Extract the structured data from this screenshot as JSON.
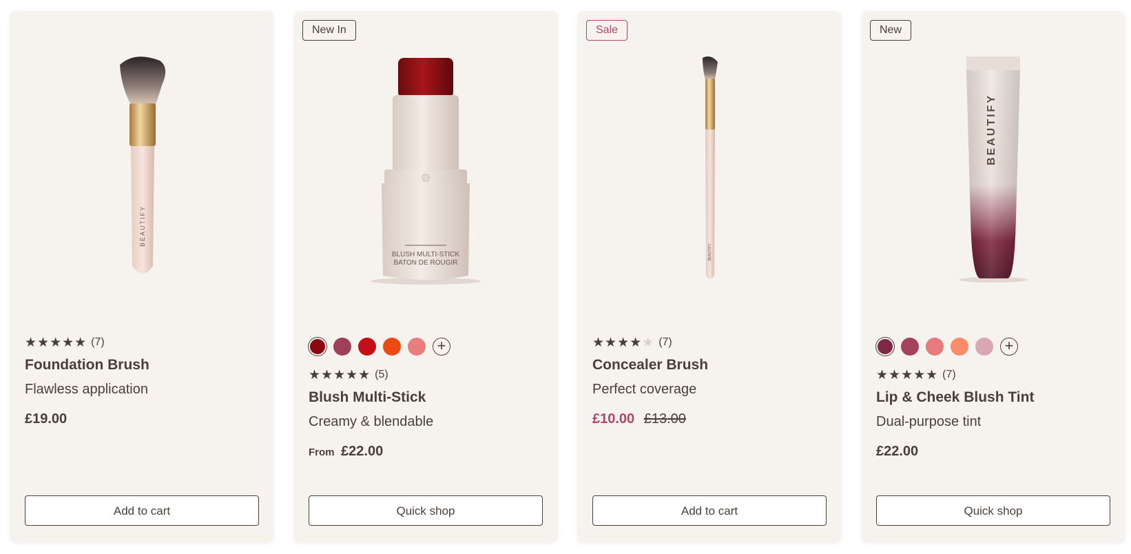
{
  "products": [
    {
      "badge": "",
      "rating_stars": "★★★★★",
      "rating_count": "(7)",
      "name": "Foundation Brush",
      "description": "Flawless application",
      "price": "£19.00",
      "button": "Add to cart",
      "brand_text": "BEAUTIFY"
    },
    {
      "badge": "New In",
      "swatches": [
        "#8c0a0f",
        "#9e4059",
        "#c30d17",
        "#ec4a12",
        "#e87e7f"
      ],
      "swatch_more": "+",
      "rating_stars": "★★★★★",
      "rating_count": "(5)",
      "name": "Blush Multi-Stick",
      "description": "Creamy & blendable",
      "price_prefix": "From",
      "price": "£22.00",
      "button": "Quick shop",
      "label_line1": "BLUSH MULTI-STICK",
      "label_line2": "BATON DE ROUGIR"
    },
    {
      "badge": "Sale",
      "rating_stars": "★★★★",
      "rating_stars_dim": "★",
      "rating_count": "(7)",
      "name": "Concealer Brush",
      "description": "Perfect coverage",
      "price": "£10.00",
      "price_old": "£13.00",
      "button": "Add to cart",
      "brand_text": "BEAUTIFY"
    },
    {
      "badge": "New",
      "swatches": [
        "#7e2a46",
        "#a3425a",
        "#e67a7c",
        "#f98b6a",
        "#dba6b4"
      ],
      "swatch_more": "+",
      "rating_stars": "★★★★★",
      "rating_count": "(7)",
      "name": "Lip & Cheek Blush Tint",
      "description": "Dual-purpose tint",
      "price": "£22.00",
      "button": "Quick shop",
      "brand_text": "BEAUTIFY"
    }
  ],
  "colors": {
    "card_bg": "#f6f2ee",
    "text": "#4a3f38",
    "sale": "#b0466a"
  }
}
